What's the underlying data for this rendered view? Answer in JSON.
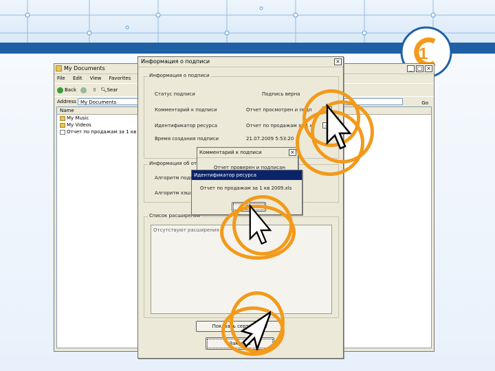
{
  "colors": {
    "banner": "#1f5fa6",
    "highlight": "#f29a1a",
    "dialog_bg": "#ece9d8"
  },
  "explorer": {
    "title": "My Documents",
    "menu": [
      "File",
      "Edit",
      "View",
      "Favorites"
    ],
    "toolbar": {
      "back": "Back",
      "search": "Sear"
    },
    "address_label": "Address",
    "address_value": "My Documents",
    "go_label": "Go",
    "column_name": "Name",
    "files": [
      "My Music",
      "My Videos",
      "Отчет по продажам за 1 кв 20"
    ]
  },
  "signature_dialog": {
    "title": "Информация о подписи",
    "group_signature": "Информация о подписи",
    "rows": [
      {
        "label": "Статус подписи",
        "value": "Подпись верна"
      },
      {
        "label": "Комментарий к подписи",
        "value": "Отчет просмотрен и подп"
      },
      {
        "label": "Идентификатор ресурса",
        "value": "Отчет по продажам за 1 к"
      },
      {
        "label": "Время создания подписи",
        "value": "21.07.2009 5:53:20"
      }
    ],
    "group_signer": "Информация об отправителе",
    "signer_rows": [
      {
        "label": "Алгоритм подп"
      },
      {
        "label": "Алгоритм хэшир"
      }
    ],
    "group_extensions": "Список расширений",
    "extensions_empty": "Отсутствуют расширения",
    "cert_button": "Показать сертификат",
    "close_button": "Закрыть"
  },
  "comment_popup": {
    "title": "Комментарий к подписи",
    "text": "Отчет проверен и подписан"
  },
  "resource_popup": {
    "title": "Идентификатор ресурса",
    "text": "Отчет по продажам за 1 кв 2009.xls",
    "ok_button": "OK"
  }
}
